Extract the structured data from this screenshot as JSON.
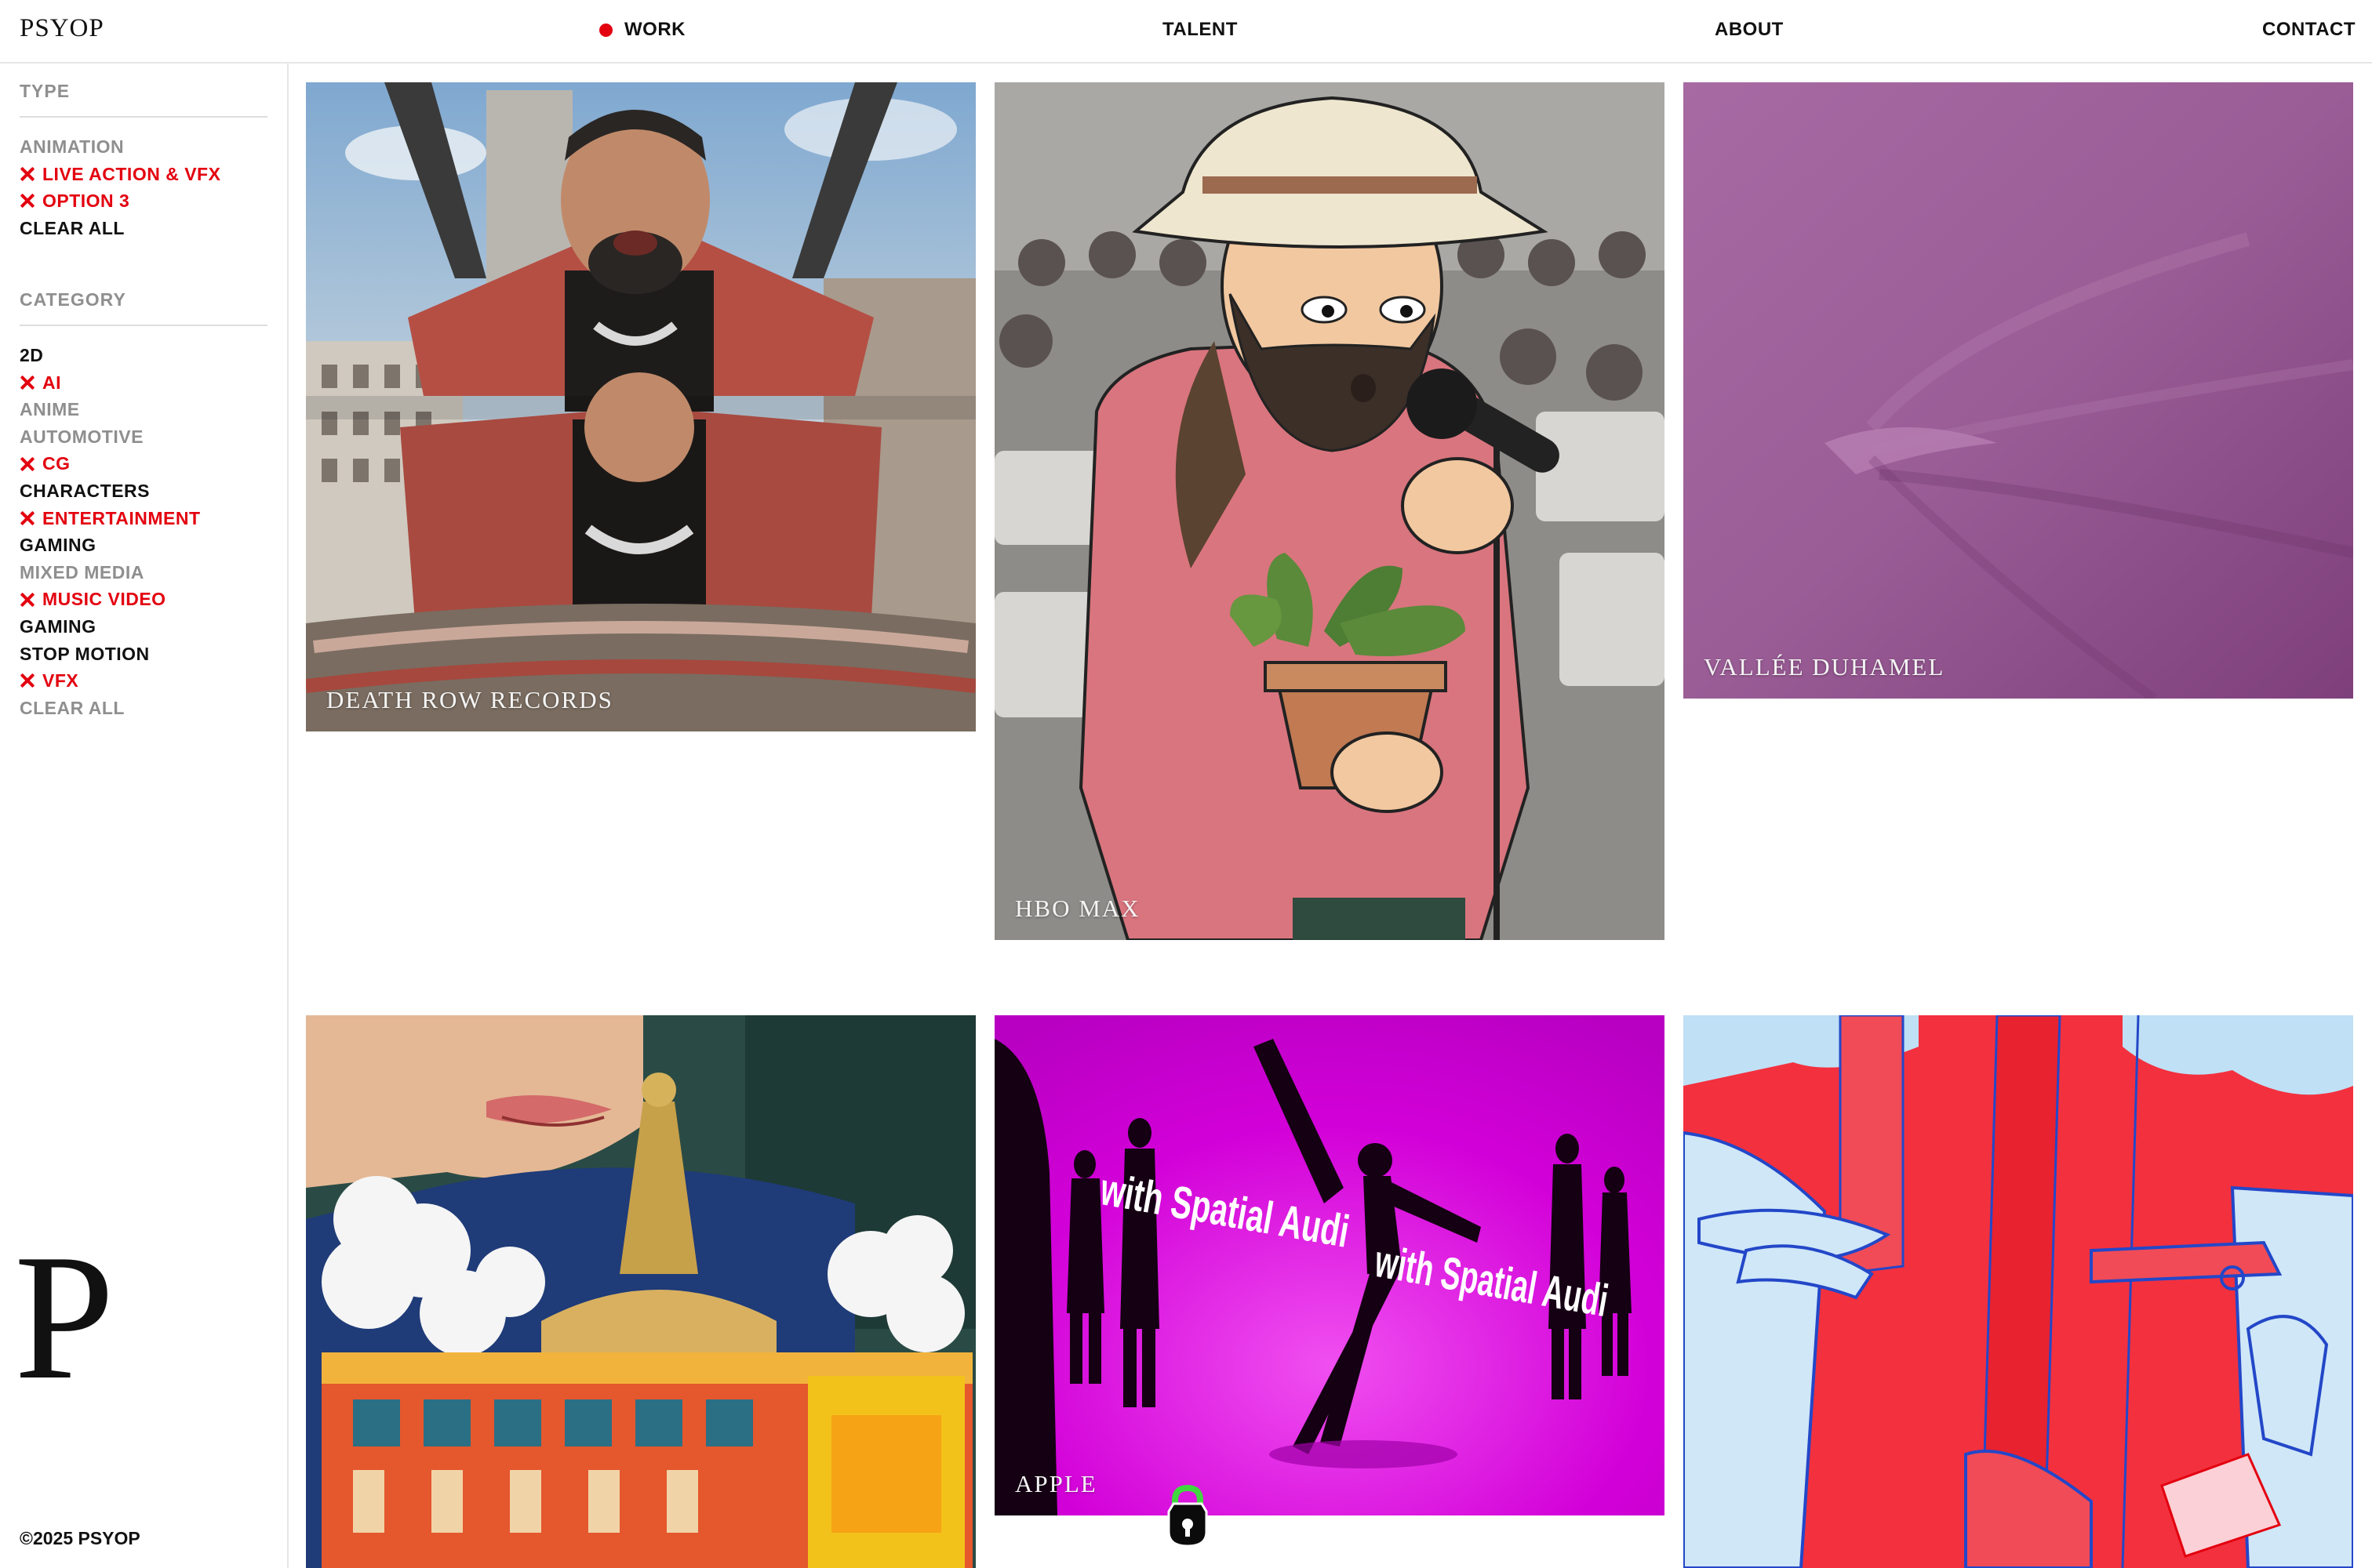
{
  "header": {
    "logo": "PSYOP",
    "nav": {
      "work": "WORK",
      "talent": "TALENT",
      "about": "ABOUT",
      "contact": "CONTACT"
    }
  },
  "sidebar": {
    "type": {
      "heading": "TYPE",
      "items": [
        {
          "label": "ANIMATION",
          "state": "inactive"
        },
        {
          "label": "LIVE ACTION & VFX",
          "state": "selected"
        },
        {
          "label": "OPTION 3",
          "state": "selected"
        },
        {
          "label": "CLEAR ALL",
          "state": "plain"
        }
      ]
    },
    "category": {
      "heading": "CATEGORY",
      "items": [
        {
          "label": "2D",
          "state": "plain"
        },
        {
          "label": "AI",
          "state": "selected"
        },
        {
          "label": "ANIME",
          "state": "inactive"
        },
        {
          "label": "AUTOMOTIVE",
          "state": "inactive"
        },
        {
          "label": "CG",
          "state": "selected"
        },
        {
          "label": "CHARACTERS",
          "state": "plain"
        },
        {
          "label": "ENTERTAINMENT",
          "state": "selected"
        },
        {
          "label": "GAMING",
          "state": "plain"
        },
        {
          "label": "MIXED MEDIA",
          "state": "inactive"
        },
        {
          "label": "MUSIC VIDEO",
          "state": "selected"
        },
        {
          "label": "GAMING",
          "state": "plain"
        },
        {
          "label": "STOP MOTION",
          "state": "plain"
        },
        {
          "label": "VFX",
          "state": "selected"
        },
        {
          "label": "CLEAR ALL",
          "state": "inactive"
        }
      ]
    },
    "monogram": "P",
    "copyright": "©2025 PSYOP"
  },
  "projects": [
    {
      "title": "DEATH ROW RECORDS"
    },
    {
      "title": "HBO MAX"
    },
    {
      "title": "VALLÉE DUHAMEL"
    },
    {
      "title": ""
    },
    {
      "title": "APPLE",
      "overlay_text": "with Spatial Audi"
    },
    {
      "title": ""
    }
  ],
  "colors": {
    "accent": "#e3000f",
    "muted": "#8f8f8f",
    "text": "#111111",
    "divider": "#e6e6e6"
  },
  "icons": {
    "selected_marker": "x-icon",
    "active_nav_marker": "red-dot-icon",
    "cursor_badge": "lock-icon"
  }
}
